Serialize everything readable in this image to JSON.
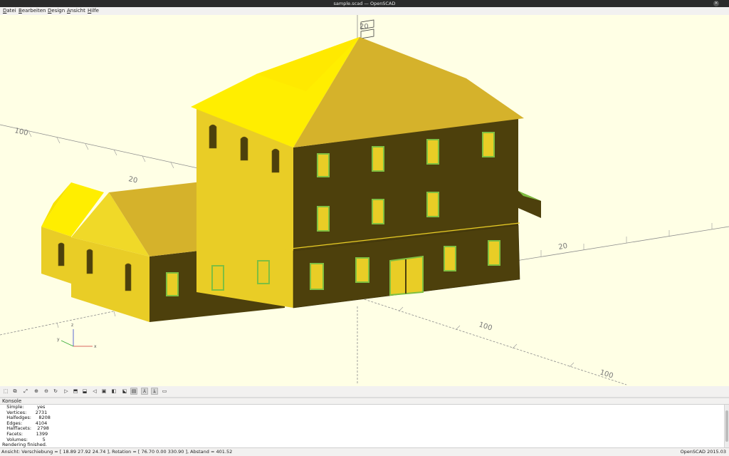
{
  "window": {
    "title": "sample.scad — OpenSCAD",
    "close_glyph": "✕"
  },
  "menu": [
    "Datei",
    "Bearbeiten",
    "Design",
    "Ansicht",
    "Hilfe"
  ],
  "viewport": {
    "background": "#ffffe5",
    "axis_label_x": "x",
    "axis_label_y": "y",
    "axis_label_z": "z",
    "scale_marks": [
      "100",
      "20",
      "20",
      "100",
      "100",
      "20"
    ]
  },
  "toolbar": {
    "icons": [
      "preview-icon",
      "render-icon",
      "zoom-all-icon",
      "zoom-in-icon",
      "zoom-out-icon",
      "reset-view-icon",
      "view-right-icon",
      "view-top-icon",
      "view-bottom-icon",
      "view-left-icon",
      "view-front-icon",
      "view-back-icon",
      "perspective-icon",
      "orthogonal-icon",
      "show-axes-icon",
      "show-scale-markers-icon",
      "show-edges-icon"
    ],
    "glyphs": [
      "⬚",
      "⧉",
      "⤢",
      "⊕",
      "⊖",
      "↻",
      "▷",
      "⬒",
      "⬓",
      "◁",
      "▣",
      "◧",
      "⬕",
      "▤",
      "⅄",
      "ﾑ",
      "▭"
    ]
  },
  "console": {
    "title": "Konsole",
    "lines": [
      "   Simple:         yes",
      "   Vertices:      2731",
      "   Halfedges:     8208",
      "   Edges:         4104",
      "   Halffacets:    2798",
      "   Facets:         1399",
      "   Volumes:          5",
      "Rendering finished."
    ]
  },
  "status": {
    "left": "Ansicht: Verschiebung = [ 18.89 27.92 24.74 ], Rotation = [ 76.70 0.00 330.90 ], Abstand = 401.52",
    "right": "OpenSCAD 2015.03"
  },
  "colors": {
    "roof": "#ffee00",
    "wall_dark": "#4d400c",
    "wall_light": "#e9cd26",
    "window_green": "#7fbf40",
    "axis_gray": "#8c8c8c"
  }
}
